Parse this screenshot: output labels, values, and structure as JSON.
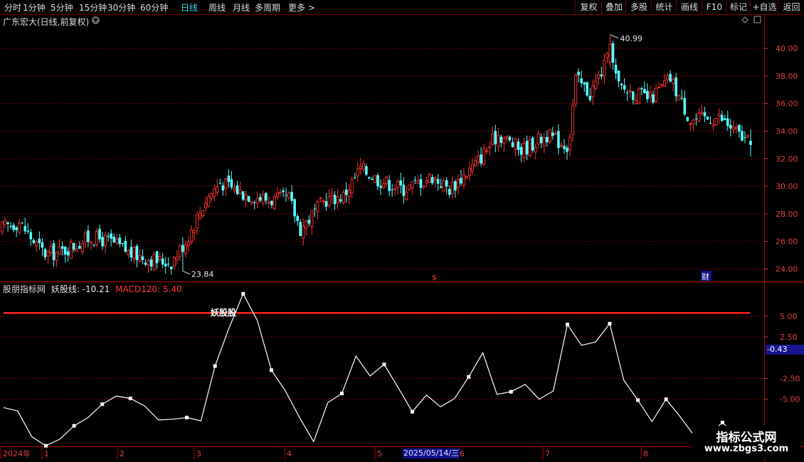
{
  "toolbar": {
    "periods": [
      "分时",
      "1分钟",
      "5分钟",
      "15分钟",
      "30分钟",
      "60分钟",
      "日线",
      "周线",
      "月线",
      "多周期",
      "更多 >"
    ],
    "active_period": "日线",
    "right_buttons": [
      "复权",
      "叠加",
      "多股",
      "统计",
      "画线",
      "F10",
      "标记",
      "+自选",
      "返回"
    ]
  },
  "main_chart": {
    "title": "广东宏大(日线,前复权)",
    "high_label": "40.99",
    "low_label": "23.84",
    "y_ticks": [
      "40.00",
      "38.00",
      "36.00",
      "34.00",
      "32.00",
      "30.00",
      "28.00",
      "26.00",
      "24.00"
    ],
    "marker_s": "$",
    "marker_cai": "财",
    "colors": {
      "up": "#ff3232",
      "down": "#54ffff",
      "grid": "#800000",
      "axis": "#e04040"
    }
  },
  "sub_chart": {
    "name": "股朋指标网",
    "line1_label": "妖股线: -10.21",
    "line2_label": "MACD120: 5.40",
    "signal_text": "妖股股",
    "y_ticks": [
      "5.00",
      "2.50",
      "-2.50",
      "-5.00"
    ],
    "current_value": "-0.43"
  },
  "x_axis": {
    "labels": [
      "2024年",
      "1",
      "2",
      "3",
      "4",
      "5",
      "6",
      "7",
      "8"
    ],
    "cursor_date": "2025/05/14/三"
  },
  "watermark": {
    "line1": "指标公式网",
    "line2": "www.zbgs3.com"
  },
  "chart_data": {
    "type": "candlestick",
    "high": 40.99,
    "low": 23.84,
    "y_range": [
      23.2,
      41.6
    ],
    "last_close": 33.0,
    "oscillator": {
      "name": "妖股线",
      "value": -10.21,
      "reference_line": 5.4,
      "y_range": [
        -10.5,
        8.5
      ],
      "path_values": [
        -6.0,
        -6.4,
        -9.5,
        -10.6,
        -9.8,
        -8.2,
        -7.2,
        -5.6,
        -4.6,
        -4.9,
        -5.8,
        -7.5,
        -7.4,
        -7.2,
        -7.6,
        -1.0,
        3.6,
        7.7,
        4.5,
        -1.5,
        -4.0,
        -7.2,
        -10.1,
        -5.4,
        -4.3,
        0.2,
        -2.2,
        -0.8,
        -3.6,
        -6.5,
        -4.5,
        -5.9,
        -4.9,
        -2.3,
        0.6,
        -4.4,
        -4.1,
        -3.2,
        -5.0,
        -4.0,
        4.0,
        1.5,
        1.9,
        4.1,
        -2.7,
        -5.1,
        -7.7,
        -5.0,
        -7.1,
        -9.4,
        -9.2,
        -7.8,
        -9.4,
        -8.6
      ]
    }
  }
}
